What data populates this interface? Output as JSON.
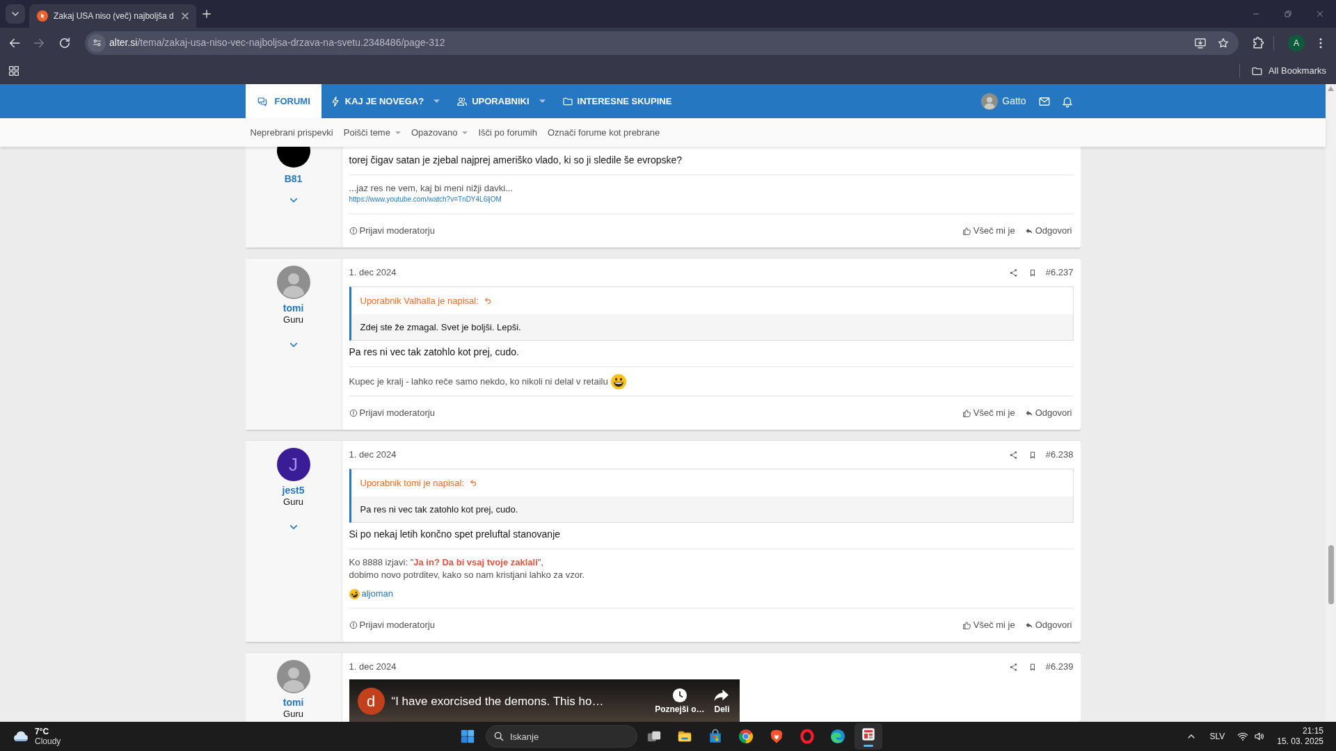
{
  "browser": {
    "tab": {
      "title": "Zakaj USA niso (več) najboljša d"
    },
    "address": {
      "host": "alter.si",
      "path": "/tema/zakaj-usa-niso-vec-najboljsa-drzava-na-svetu.2348486/page-312"
    },
    "profile": {
      "initial": "A"
    },
    "bookmarks": {
      "label": "All Bookmarks"
    }
  },
  "nav": {
    "items": [
      {
        "label": "FORUMI",
        "selected": true,
        "dropdown": false
      },
      {
        "label": "KAJ JE NOVEGA?",
        "selected": false,
        "dropdown": true
      },
      {
        "label": "UPORABNIKI",
        "selected": false,
        "dropdown": true
      },
      {
        "label": "INTERESNE SKUPINE",
        "selected": false,
        "dropdown": false
      }
    ],
    "user": {
      "name": "Gatto"
    }
  },
  "subnav": {
    "items": [
      {
        "label": "Neprebrani prispevki",
        "dropdown": false
      },
      {
        "label": "Poišči teme",
        "dropdown": true
      },
      {
        "label": "Opazovano",
        "dropdown": true
      },
      {
        "label": "Išči po forumih",
        "dropdown": false
      },
      {
        "label": "Označi forume kot prebrane",
        "dropdown": false
      }
    ]
  },
  "posts": [
    {
      "author": {
        "name": "B81",
        "avatar": {
          "kind": "solid"
        }
      },
      "body": "torej čigav satan je zjebal najprej ameriško vlado, ki so ji sledile še evropske?",
      "signature": [
        {
          "kind": "text",
          "segments": [
            {
              "kind": "plain",
              "text": "...jaz res ne vem, kaj bi meni nižji davki..."
            }
          ]
        },
        {
          "kind": "link",
          "text": "https://www.youtube.com/watch?v=TnDY4L6ljOM"
        }
      ],
      "footer": {
        "report": "Prijavi moderatorju",
        "like": "Všeč mi je",
        "reply": "Odgovori"
      }
    },
    {
      "author": {
        "name": "tomi",
        "title": "Guru",
        "avatar": {
          "kind": "photo"
        }
      },
      "date": "1. dec 2024",
      "number": "#6.237",
      "quote": {
        "header": "Uporabnik Valhalla je napisal:",
        "text": "Zdej ste že zmagal. Svet je boljši. Lepši."
      },
      "body": "Pa res ni vec tak zatohlo kot prej, cudo.",
      "signature": [
        {
          "kind": "text",
          "segments": [
            {
              "kind": "plain",
              "text": "Kupec je kralj - lahko reče samo nekdo, ko nikoli ni delal v retailu"
            },
            {
              "kind": "emoji"
            }
          ]
        }
      ],
      "footer": {
        "report": "Prijavi moderatorju",
        "like": "Všeč mi je",
        "reply": "Odgovori"
      }
    },
    {
      "author": {
        "name": "jest5",
        "title": "Guru",
        "avatar": {
          "kind": "letter",
          "letter": "J"
        }
      },
      "date": "1. dec 2024",
      "number": "#6.238",
      "quote": {
        "header": "Uporabnik tomi je napisal:",
        "text": "Pa res ni vec tak zatohlo kot prej, cudo."
      },
      "body": "Si po nekaj letih končno spet preluftal stanovanje",
      "signature": [
        {
          "kind": "text",
          "segments": [
            {
              "kind": "plain",
              "text": "Ko 8888 izjavi: \""
            },
            {
              "kind": "highlight",
              "text": "Ja in? Da bi vsaj tvoje zaklali"
            },
            {
              "kind": "plain",
              "text": "\","
            }
          ]
        },
        {
          "kind": "text",
          "segments": [
            {
              "kind": "plain",
              "text": "dobimo novo potrditev, kako so nam kristjani lahko za vzor."
            }
          ]
        }
      ],
      "reactions": [
        {
          "user": "aljoman"
        }
      ],
      "footer": {
        "report": "Prijavi moderatorju",
        "like": "Všeč mi je",
        "reply": "Odgovori"
      }
    },
    {
      "author": {
        "name": "tomi",
        "title": "Guru",
        "avatar": {
          "kind": "photo"
        }
      },
      "date": "1. dec 2024",
      "number": "#6.239",
      "video": {
        "channel_initial": "d",
        "title": "“I have exorcised the demons. This ho…",
        "actions": [
          {
            "label": "Poznejši o…"
          },
          {
            "label": "Deli"
          }
        ]
      }
    }
  ],
  "taskbar": {
    "weather": {
      "temperature": "7°C",
      "condition": "Cloudy"
    },
    "search": {
      "placeholder": "Iskanje"
    },
    "apps": [
      {
        "selected": false
      },
      {
        "selected": false
      },
      {
        "selected": false
      },
      {
        "selected": false
      },
      {
        "selected": false
      },
      {
        "selected": false
      },
      {
        "selected": false
      },
      {
        "selected": true
      }
    ],
    "tray": {
      "language": "SLV",
      "time": "21:15",
      "date": "15. 03. 2025"
    }
  }
}
